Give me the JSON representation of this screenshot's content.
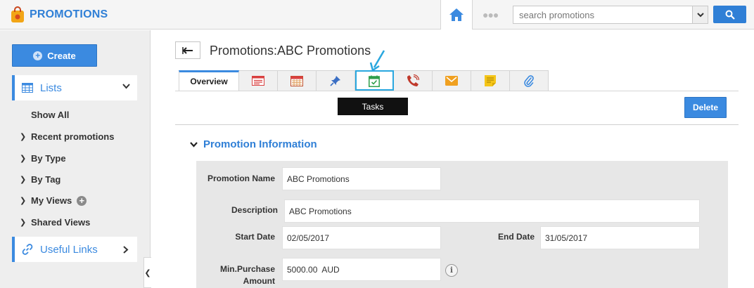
{
  "app": {
    "title": "PROMOTIONS"
  },
  "search": {
    "placeholder": "search promotions"
  },
  "colors": {
    "accent": "#3b8ae0",
    "brand": "#2f7fd6",
    "highlight": "#29a7df"
  },
  "sidebar": {
    "create_label": "Create",
    "lists_label": "Lists",
    "items": [
      {
        "label": "Show All",
        "has_arrow": false
      },
      {
        "label": "Recent promotions",
        "has_arrow": true
      },
      {
        "label": "By Type",
        "has_arrow": true
      },
      {
        "label": "By Tag",
        "has_arrow": true
      },
      {
        "label": "My Views",
        "has_arrow": true
      },
      {
        "label": "Shared Views",
        "has_arrow": true
      }
    ],
    "useful_links_label": "Useful Links"
  },
  "page": {
    "title": "Promotions:ABC Promotions",
    "tabs": [
      {
        "label": "Overview",
        "icon": "overview"
      },
      {
        "label": "",
        "icon": "notes-icon"
      },
      {
        "label": "",
        "icon": "calendar-icon"
      },
      {
        "label": "",
        "icon": "pin-icon"
      },
      {
        "label": "",
        "icon": "tasks-icon"
      },
      {
        "label": "",
        "icon": "phone-icon"
      },
      {
        "label": "",
        "icon": "mail-icon"
      },
      {
        "label": "",
        "icon": "sticky-note-icon"
      },
      {
        "label": "",
        "icon": "attachment-icon"
      }
    ],
    "tooltip": "Tasks",
    "delete_label": "Delete",
    "section_title": "Promotion Information"
  },
  "form": {
    "promotion_name_label": "Promotion Name",
    "promotion_name_value": "ABC Promotions",
    "description_label": "Description",
    "description_value": "ABC Promotions",
    "start_date_label": "Start Date",
    "start_date_value": "02/05/2017",
    "end_date_label": "End Date",
    "end_date_value": "31/05/2017",
    "min_purchase_label_1": "Min.Purchase",
    "min_purchase_label_2": "Amount",
    "min_purchase_value": "5000.00  AUD"
  }
}
